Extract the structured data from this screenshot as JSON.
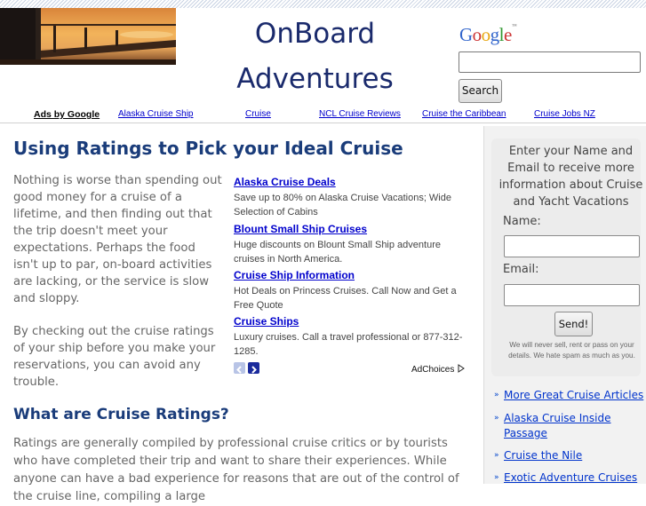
{
  "header": {
    "title_line1": "OnBoard",
    "title_line2": "Adventures",
    "google_letters": [
      "G",
      "o",
      "o",
      "g",
      "l",
      "e"
    ],
    "google_colors": [
      "#3366cc",
      "#cc3333",
      "#e8a612",
      "#3366cc",
      "#339933",
      "#cc3333"
    ],
    "google_tm": "™",
    "search_button": "Search"
  },
  "adbar": {
    "label": "Ads by Google",
    "links": [
      "Alaska Cruise Ship",
      "Cruise",
      "NCL Cruise Reviews",
      "Cruise the Caribbean",
      "Cruise Jobs NZ"
    ]
  },
  "article": {
    "heading": "Using Ratings to Pick your Ideal Cruise",
    "intro_p1": "Nothing is worse than spending out good money for a cruise of a lifetime, and then finding out that the trip doesn't meet your expectations.  Perhaps the food isn't up to par, on-board activities are lacking, or the service is slow and sloppy.",
    "intro_p2": "By checking out the cruise ratings of your ship before you make your reservations, you can avoid any trouble.",
    "subheading": "What are Cruise Ratings?",
    "para2": "Ratings are generally compiled by professional cruise critics or by tourists who have completed their trip and want to share their experiences.  While anyone can have a bad experience for reasons that are out of the control of the cruise line, compiling a large"
  },
  "ads": [
    {
      "title": "Alaska Cruise Deals",
      "desc": "Save up to 80% on Alaska Cruise Vacations; Wide Selection of Cabins"
    },
    {
      "title": "Blount Small Ship Cruises",
      "desc": "Huge discounts on Blount Small Ship adventure cruises in North America."
    },
    {
      "title": "Cruise Ship Information",
      "desc": "Hot Deals on Princess Cruises. Call Now and Get a Free Quote"
    },
    {
      "title": "Cruise Ships",
      "desc": "Luxury cruises. Call a travel professional or 877-312-1285."
    }
  ],
  "adchoices": "AdChoices",
  "sidebar": {
    "optin_heading": "Enter your Name and Email to receive more information about Cruise and Yacht Vacations",
    "name_label": "Name:",
    "email_label": "Email:",
    "send_button": "Send!",
    "spam_note": "We will never sell, rent or pass on your details. We hate spam as much as you.",
    "links": [
      "More Great Cruise Articles",
      "Alaska Cruise Inside Passage",
      "Cruise the Nile",
      "Exotic Adventure Cruises"
    ]
  }
}
